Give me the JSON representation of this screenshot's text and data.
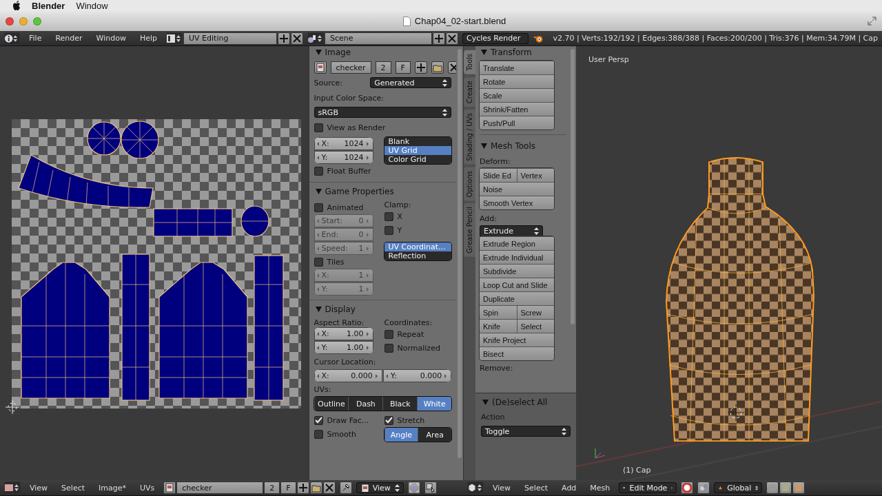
{
  "menubar": {
    "app": "Blender",
    "items": [
      "Window"
    ]
  },
  "titlebar": {
    "title": "Chap04_02-start.blend"
  },
  "info_header": {
    "menus": [
      "File",
      "Render",
      "Window",
      "Help"
    ],
    "screen": "UV Editing",
    "scene": "Scene",
    "engine": "Cycles Render",
    "stats": "v2.70 | Verts:192/192 | Edges:388/388 | Faces:200/200 | Tris:376 | Mem:34.79M | Cap"
  },
  "image_panel": {
    "header": "Image",
    "image_name": "checker",
    "users": "2",
    "fake_user": "F",
    "source_label": "Source:",
    "source": "Generated",
    "color_space_label": "Input Color Space:",
    "color_space": "sRGB",
    "view_as_render": {
      "label": "View as Render",
      "checked": false
    },
    "size": [
      {
        "axis": "X:",
        "value": "1024",
        "disabled": false
      },
      {
        "axis": "Y:",
        "value": "1024",
        "disabled": false
      }
    ],
    "types": [
      {
        "label": "Blank",
        "selected": false
      },
      {
        "label": "UV Grid",
        "selected": true
      },
      {
        "label": "Color Grid",
        "selected": false
      }
    ],
    "float_buffer": {
      "label": "Float Buffer",
      "checked": false
    }
  },
  "game_panel": {
    "header": "Game Properties",
    "animated": {
      "label": "Animated",
      "checked": false
    },
    "anim_fields": [
      {
        "axis": "Start:",
        "value": "0",
        "disabled": true
      },
      {
        "axis": "End:",
        "value": "0",
        "disabled": true
      },
      {
        "axis": "Speed:",
        "value": "1",
        "disabled": true
      }
    ],
    "clamp_label": "Clamp:",
    "clamp": [
      {
        "label": "X",
        "checked": false
      },
      {
        "label": "Y",
        "checked": false
      }
    ],
    "mapping": [
      {
        "label": "UV Coordinat...",
        "selected": true
      },
      {
        "label": "Reflection",
        "selected": false
      }
    ],
    "tiles": {
      "label": "Tiles",
      "checked": false
    },
    "tile_fields": [
      {
        "axis": "X:",
        "value": "1",
        "disabled": true
      },
      {
        "axis": "Y:",
        "value": "1",
        "disabled": true
      }
    ]
  },
  "display_panel": {
    "header": "Display",
    "aspect_label": "Aspect Ratio:",
    "aspect": [
      {
        "axis": "X:",
        "value": "1.00",
        "disabled": false
      },
      {
        "axis": "Y:",
        "value": "1.00",
        "disabled": false
      }
    ],
    "coords_label": "Coordinates:",
    "coords": [
      {
        "label": "Repeat",
        "checked": false
      },
      {
        "label": "Normalized",
        "checked": false
      }
    ],
    "cursor_label": "Cursor Location:",
    "cursor": [
      {
        "axis": "X:",
        "value": "0.000",
        "disabled": false
      },
      {
        "axis": "Y:",
        "value": "0.000",
        "disabled": false
      }
    ],
    "uvs_label": "UVs:",
    "uv_styles": [
      {
        "label": "Outline",
        "selected": false
      },
      {
        "label": "Dash",
        "selected": false
      },
      {
        "label": "Black",
        "selected": false
      },
      {
        "label": "White",
        "selected": true
      }
    ],
    "options": [
      {
        "label": "Draw Fac...",
        "checked": true
      },
      {
        "label": "Stretch",
        "checked": true
      },
      {
        "label": "Smooth",
        "checked": false
      }
    ],
    "stretch_modes": [
      {
        "label": "Angle",
        "selected": true
      },
      {
        "label": "Area",
        "selected": false
      }
    ]
  },
  "tool_tabs": [
    {
      "label": "Tools",
      "selected": true
    },
    {
      "label": "Create",
      "selected": false
    },
    {
      "label": "Shading / UVs",
      "selected": false
    },
    {
      "label": "Options",
      "selected": false
    },
    {
      "label": "Grease Pencil",
      "selected": false
    }
  ],
  "transform_panel": {
    "header": "Transform",
    "buttons": [
      "Translate",
      "Rotate",
      "Scale",
      "Shrink/Fatten",
      "Push/Pull"
    ]
  },
  "mesh_tools_panel": {
    "header": "Mesh Tools",
    "deform_label": "Deform:",
    "deform_rows": [
      [
        "Slide Ed",
        "Vertex"
      ],
      [
        "Noise"
      ],
      [
        "Smooth Vertex"
      ]
    ],
    "add_label": "Add:",
    "extrude": "Extrude",
    "add_rows": [
      [
        "Extrude Region"
      ],
      [
        "Extrude Individual"
      ],
      [
        "Subdivide"
      ],
      [
        "Loop Cut and Slide"
      ],
      [
        "Duplicate"
      ],
      [
        "Spin",
        "Screw"
      ],
      [
        "Knife",
        "Select"
      ],
      [
        "Knife Project"
      ],
      [
        "Bisect"
      ]
    ],
    "remove_label": "Remove:"
  },
  "operator_panel": {
    "header": "(De)select All",
    "action_label": "Action",
    "action": "Toggle"
  },
  "viewport": {
    "view_label": "User Persp",
    "object_label": "(1) Cap"
  },
  "uv_header": {
    "menus": [
      "View",
      "Select",
      "Image*",
      "UVs"
    ],
    "image_name": "checker",
    "users": "2",
    "fake_user": "F",
    "view": "View"
  },
  "view3d_header": {
    "menus": [
      "View",
      "Select",
      "Add",
      "Mesh"
    ],
    "mode": "Edit Mode",
    "orientation": "Global"
  }
}
